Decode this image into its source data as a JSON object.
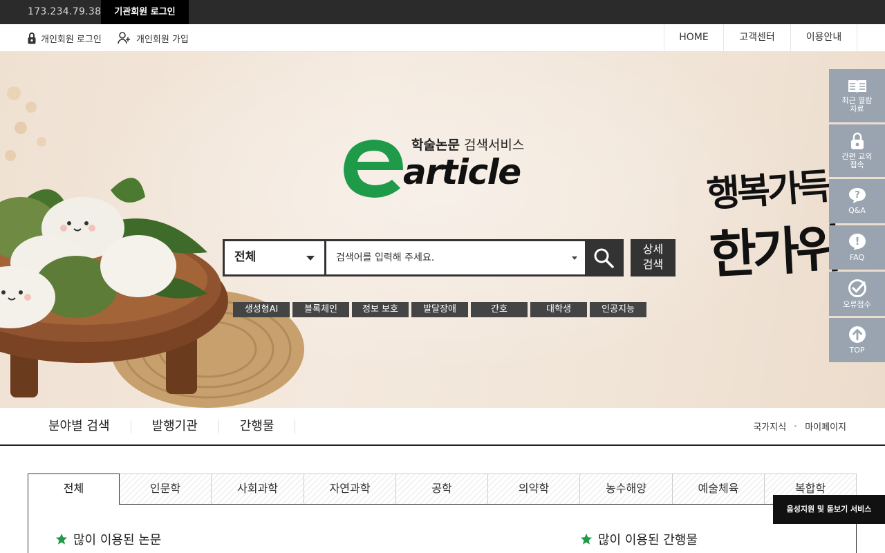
{
  "topbar": {
    "ip": "173.234.79.38",
    "institution_login": "기관회원 로그인"
  },
  "userbar": {
    "login": "개인회원 로그인",
    "join": "개인회원 가입"
  },
  "nav": [
    {
      "label": "HOME"
    },
    {
      "label": "고객센터"
    },
    {
      "label": "이용안내"
    }
  ],
  "logo": {
    "tag_bold": "학술논문",
    "tag": " 검색서비스",
    "word": "article"
  },
  "search": {
    "scope": "전체",
    "placeholder": "검색어를 입력해 주세요.",
    "advanced_line1": "상세",
    "advanced_line2": "검색"
  },
  "keywords": [
    "생성형AI",
    "블록체인",
    "정보 보호",
    "발달장애",
    "간호",
    "대학생",
    "인공지능"
  ],
  "banner": {
    "line1": "행복가득",
    "line2": "한가위"
  },
  "quick_menu": [
    {
      "label": "최근 열람 자료",
      "icon": "book-icon"
    },
    {
      "label": "간편 교외접속",
      "icon": "lock-icon"
    },
    {
      "label": "Q&A",
      "icon": "question-bubble-icon"
    },
    {
      "label": "FAQ",
      "icon": "exclamation-bubble-icon"
    },
    {
      "label": "오류접수",
      "icon": "check-circle-icon"
    },
    {
      "label": "TOP",
      "icon": "arrow-up-circle-icon"
    }
  ],
  "category_nav": {
    "items": [
      "분야별 검색",
      "발행기관",
      "간행물"
    ],
    "right": [
      "국가지식",
      "마이페이지"
    ]
  },
  "tabs": [
    "전체",
    "인문학",
    "사회과학",
    "자연과학",
    "공학",
    "의약학",
    "농수해양",
    "예술체육",
    "복합학"
  ],
  "sections": {
    "popular_papers": "많이 이용된 논문",
    "popular_journals": "많이 이용된 간행물"
  },
  "voice_service": "음성지원 및 돋보기 서비스",
  "colors": {
    "brand_green": "#1e9a48",
    "dark": "#333333",
    "quick_bg": "#9aa4b0",
    "star": "#1e9a48"
  }
}
